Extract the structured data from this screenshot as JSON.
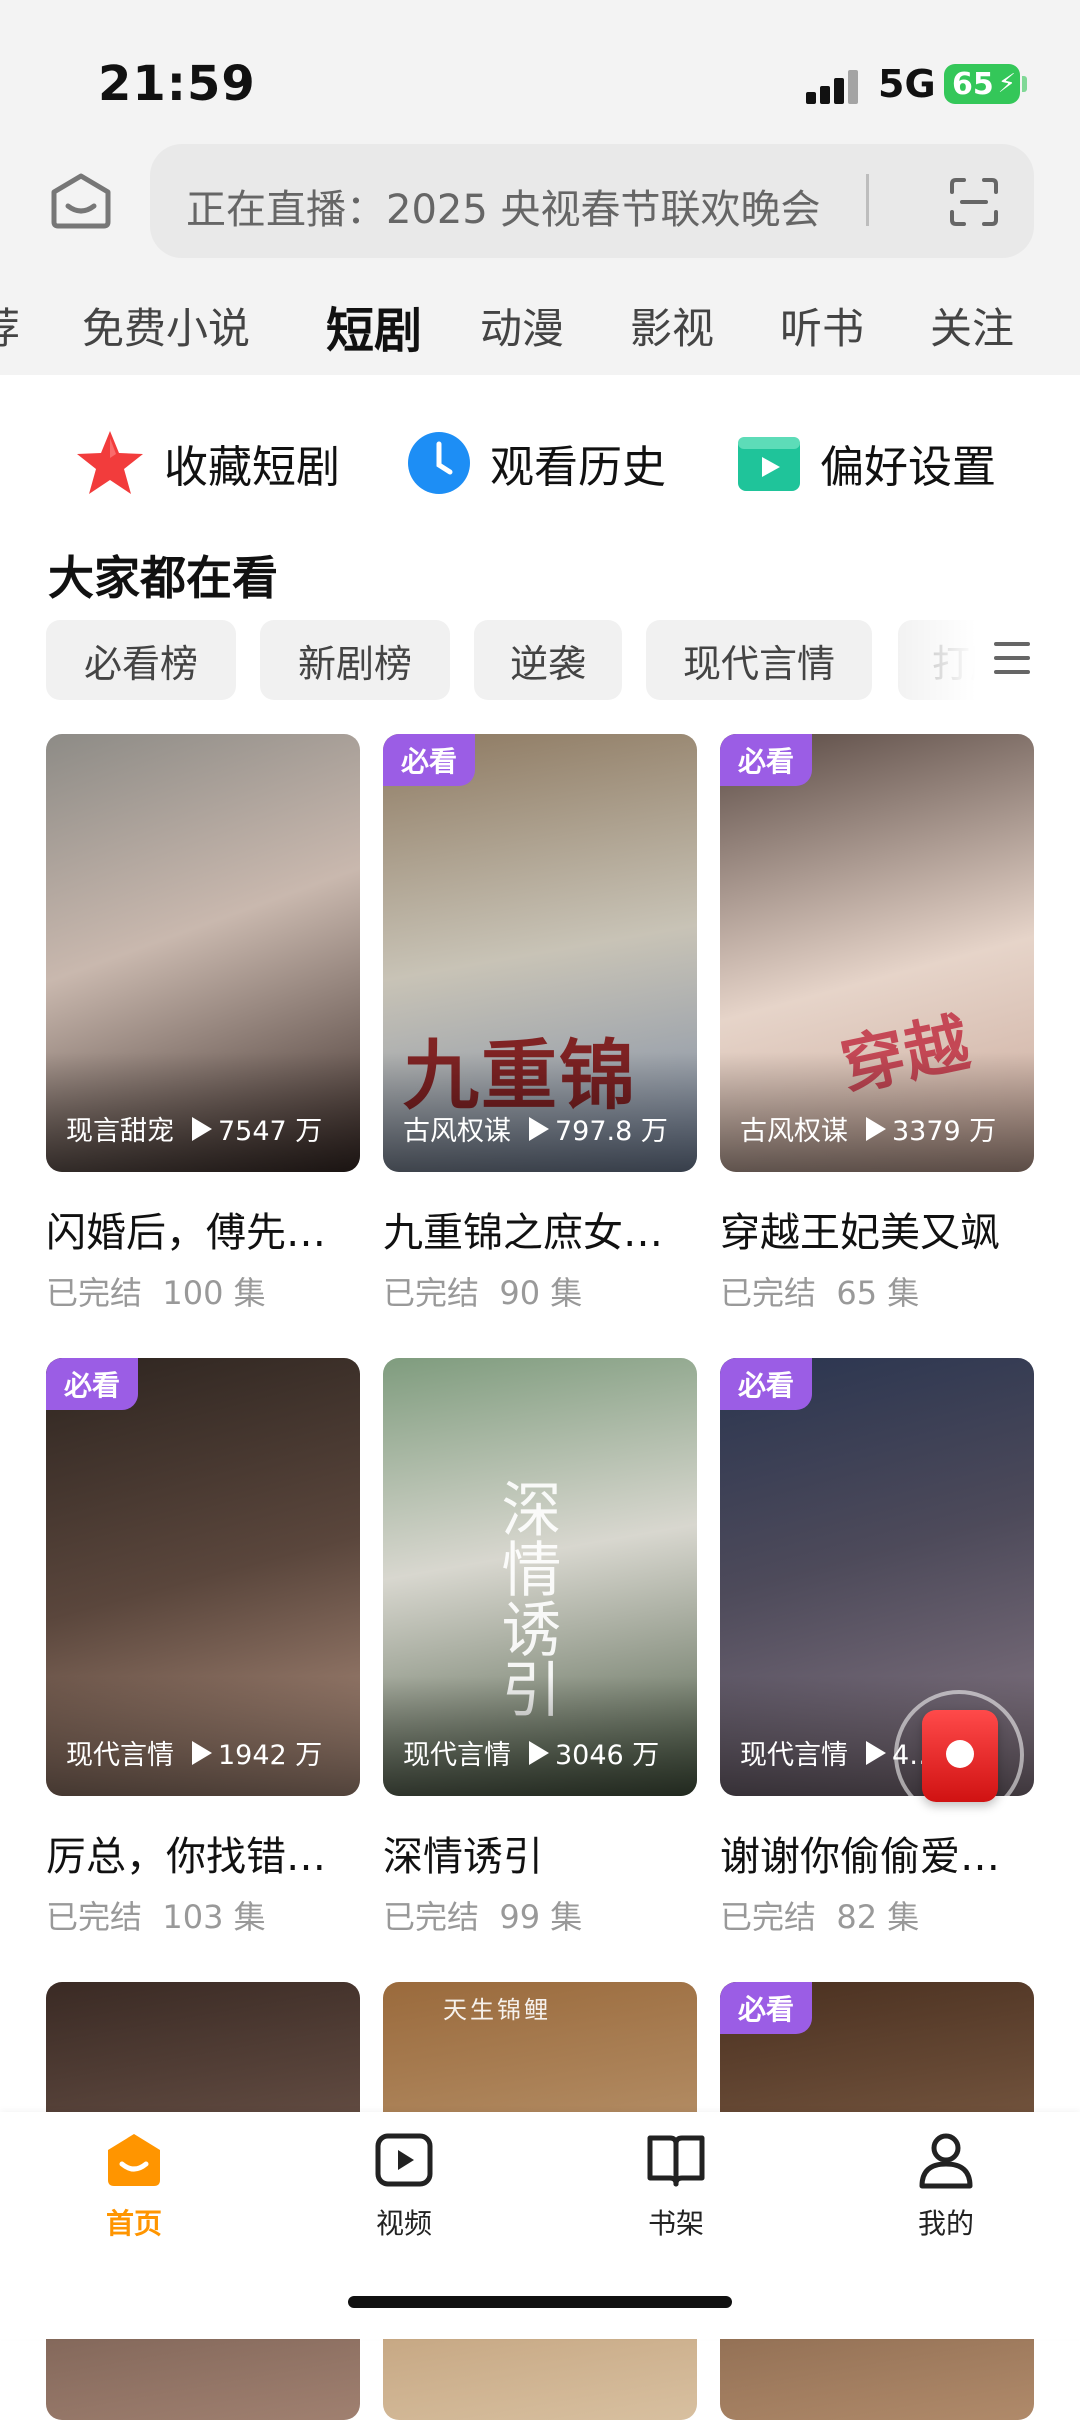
{
  "status_bar": {
    "time": "21:59",
    "network": "5G",
    "battery": "65"
  },
  "search": {
    "placeholder_text": "正在直播：2025 央视春节联欢晚会"
  },
  "category_tabs": [
    {
      "label": "荐"
    },
    {
      "label": "免费小说"
    },
    {
      "label": "短剧",
      "active": true
    },
    {
      "label": "动漫"
    },
    {
      "label": "影视"
    },
    {
      "label": "听书"
    },
    {
      "label": "关注"
    }
  ],
  "shortcuts": [
    {
      "label": "收藏短剧",
      "icon": "star-icon",
      "color": "#f23c3c"
    },
    {
      "label": "观看历史",
      "icon": "clock-icon",
      "color": "#1d8ef5"
    },
    {
      "label": "偏好设置",
      "icon": "play-folder-icon",
      "color": "#1fc49a"
    }
  ],
  "section_title": "大家都在看",
  "filter_chips": [
    {
      "label": "必看榜"
    },
    {
      "label": "新剧榜"
    },
    {
      "label": "逆袭"
    },
    {
      "label": "现代言情"
    },
    {
      "label": "打脸"
    }
  ],
  "badge_label": "必看",
  "dramas": [
    {
      "title": "闪婚后，傅先…",
      "genre": "现言甜宠",
      "views": "7547 万",
      "status": "已完结",
      "episodes": "100 集",
      "badge": false,
      "poster_colors": [
        "#8d8b86",
        "#d9c2b7"
      ]
    },
    {
      "title": "九重锦之庶女…",
      "genre": "古风权谋",
      "views": "797.8 万",
      "status": "已完结",
      "episodes": "90 集",
      "badge": true,
      "poster_colors": [
        "#8e7a62",
        "#c8c3b6"
      ],
      "poster_art": "九重锦"
    },
    {
      "title": "穿越王妃美又飒",
      "genre": "古风权谋",
      "views": "3379 万",
      "status": "已完结",
      "episodes": "65 集",
      "badge": true,
      "poster_colors": [
        "#6b5a52",
        "#e6d4c9"
      ],
      "poster_art": "穿越"
    },
    {
      "title": "厉总，你找错…",
      "genre": "现代言情",
      "views": "1942 万",
      "status": "已完结",
      "episodes": "103 集",
      "badge": true,
      "poster_colors": [
        "#2e2520",
        "#7a5f52"
      ]
    },
    {
      "title": "深情诱引",
      "genre": "现代言情",
      "views": "3046 万",
      "status": "已完结",
      "episodes": "99 集",
      "badge": false,
      "poster_colors": [
        "#7f9c7e",
        "#d8d7cf"
      ],
      "poster_art": "深情诱引"
    },
    {
      "title": "谢谢你偷偷爱…",
      "genre": "现代言情",
      "views": "4…万",
      "status": "已完结",
      "episodes": "82 集",
      "badge": true,
      "poster_colors": [
        "#2a3550",
        "#8a7a86"
      ]
    },
    {
      "title": "",
      "genre": "",
      "views": "",
      "status": "",
      "episodes": "",
      "badge": false,
      "poster_colors": [
        "#3a2a24",
        "#a08070"
      ]
    },
    {
      "title": "",
      "genre": "",
      "views": "",
      "status": "",
      "episodes": "",
      "badge": false,
      "poster_colors": [
        "#9a6a3c",
        "#d8c0a0"
      ],
      "poster_art": "天生锦鲤"
    },
    {
      "title": "",
      "genre": "",
      "views": "",
      "status": "",
      "episodes": "",
      "badge": true,
      "poster_colors": [
        "#4a3020",
        "#b08a6a"
      ]
    }
  ],
  "bottom_nav": [
    {
      "label": "首页",
      "icon": "home-icon",
      "active": true
    },
    {
      "label": "视频",
      "icon": "video-icon",
      "active": false
    },
    {
      "label": "书架",
      "icon": "bookshelf-icon",
      "active": false
    },
    {
      "label": "我的",
      "icon": "profile-icon",
      "active": false
    }
  ],
  "colors": {
    "accent": "#ff9500",
    "badge": "#9b5de5",
    "battery": "#34c759"
  }
}
